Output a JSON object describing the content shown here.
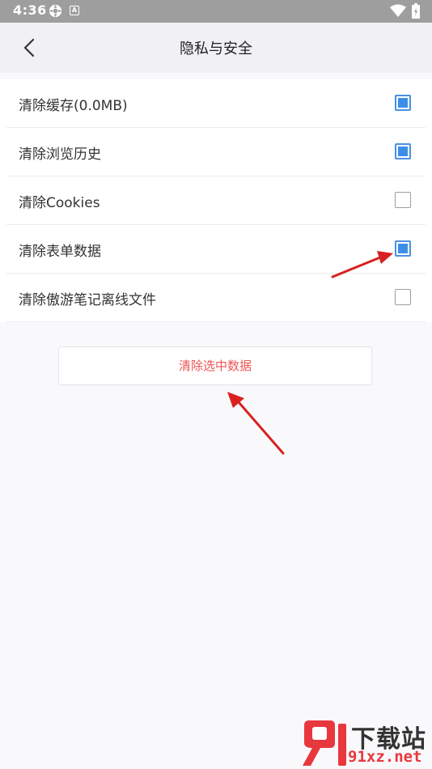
{
  "status_bar": {
    "time": "4:36",
    "icons": [
      "settings-icon",
      "a-icon",
      "wifi-icon",
      "battery-icon"
    ]
  },
  "header": {
    "title": "隐私与安全",
    "back_icon": "chevron-left-icon"
  },
  "options": [
    {
      "label": "清除缓存(0.0MB)",
      "checked": true
    },
    {
      "label": "清除浏览历史",
      "checked": true
    },
    {
      "label": "清除Cookies",
      "checked": false
    },
    {
      "label": "清除表单数据",
      "checked": true
    },
    {
      "label": "清除傲游笔记离线文件",
      "checked": false
    }
  ],
  "clear_button": {
    "label": "清除选中数据"
  },
  "colors": {
    "checkbox_checked": "#3b8fe8",
    "button_text": "#ee5555",
    "arrow": "#d92020"
  },
  "watermark": {
    "title": "下载站",
    "url": "91xz.net"
  }
}
